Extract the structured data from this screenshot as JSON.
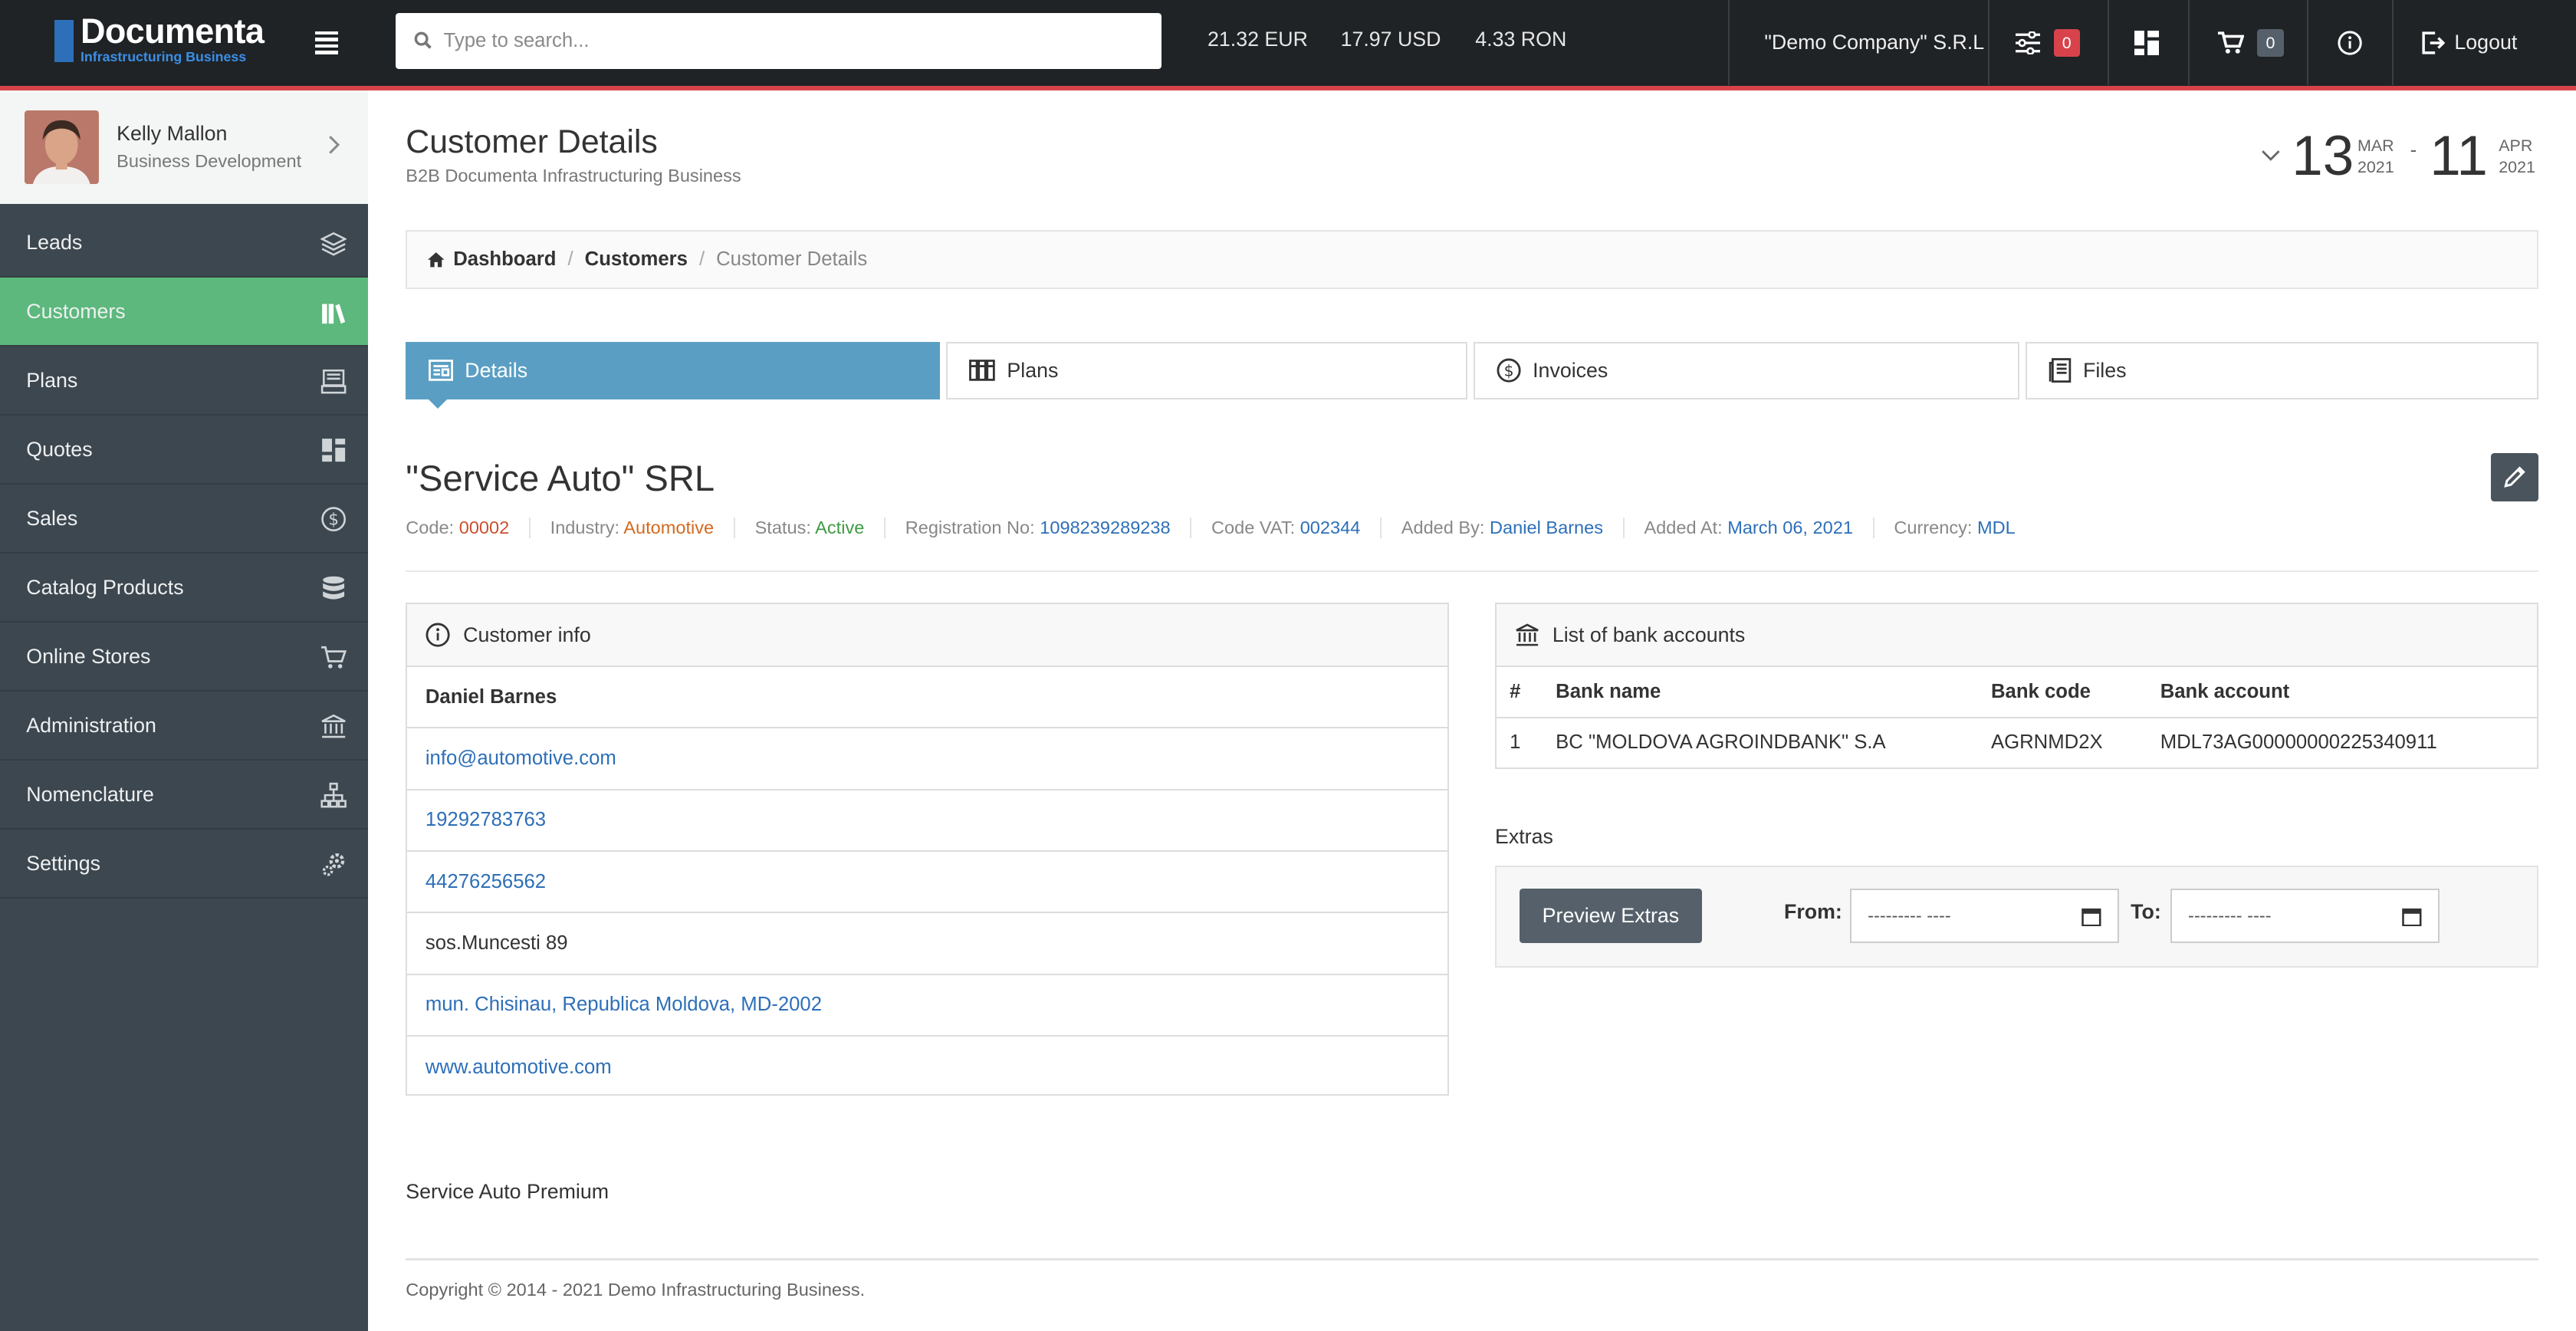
{
  "header": {
    "logo_title": "Documenta",
    "logo_subtitle": "Infrastructuring Business",
    "search_placeholder": "Type to search...",
    "rates": [
      "21.32 EUR",
      "17.97 USD",
      "4.33 RON"
    ],
    "company": "\"Demo Company\" S.R.L",
    "filters_badge": "0",
    "cart_badge": "0",
    "logout_label": "Logout",
    "colors": {
      "bar": "#1f2326",
      "accent_line": "#d8434b",
      "badge_red": "#d8434b",
      "badge_dark": "#55606a"
    }
  },
  "profile": {
    "name": "Kelly Mallon",
    "role": "Business Development"
  },
  "sidebar": {
    "items": [
      {
        "label": "Leads",
        "icon": "layers-icon"
      },
      {
        "label": "Customers",
        "icon": "books-icon",
        "active": true
      },
      {
        "label": "Plans",
        "icon": "register-icon"
      },
      {
        "label": "Quotes",
        "icon": "quotes-icon"
      },
      {
        "label": "Sales",
        "icon": "dollar-circle-icon"
      },
      {
        "label": "Catalog Products",
        "icon": "database-icon"
      },
      {
        "label": "Online Stores",
        "icon": "cart-icon"
      },
      {
        "label": "Administration",
        "icon": "bank-icon"
      },
      {
        "label": "Nomenclature",
        "icon": "sitemap-icon"
      },
      {
        "label": "Settings",
        "icon": "gears-icon"
      }
    ],
    "active_color": "#5cb87c"
  },
  "page": {
    "title": "Customer Details",
    "subtitle": "B2B Documenta Infrastructuring Business",
    "date_from": {
      "day": "13",
      "month": "MAR",
      "year": "2021"
    },
    "date_sep": "-",
    "date_to": {
      "day": "11",
      "month": "APR",
      "year": "2021"
    }
  },
  "breadcrumb": {
    "items": [
      "Dashboard",
      "Customers"
    ],
    "current": "Customer Details"
  },
  "tabs": [
    {
      "label": "Details",
      "icon": "details-icon",
      "active": true
    },
    {
      "label": "Plans",
      "icon": "plans-icon"
    },
    {
      "label": "Invoices",
      "icon": "dollar-circle-icon"
    },
    {
      "label": "Files",
      "icon": "files-icon"
    }
  ],
  "customer": {
    "name": "\"Service Auto\" SRL",
    "meta": [
      {
        "label": "Code:",
        "value": "00002"
      },
      {
        "label": "Industry:",
        "value": "Automotive"
      },
      {
        "label": "Status:",
        "value": "Active"
      },
      {
        "label": "Registration No:",
        "value": "1098239289238"
      },
      {
        "label": "Code VAT:",
        "value": "002344"
      },
      {
        "label": "Added By:",
        "value": "Daniel Barnes"
      },
      {
        "label": "Added At:",
        "value": "March 06, 2021"
      },
      {
        "label": "Currency:",
        "value": "MDL"
      }
    ],
    "info_title": "Customer info",
    "contact": "Daniel Barnes",
    "email": "info@automotive.com",
    "phone1": "19292783763",
    "phone2": "44276256562",
    "street": "sos.Muncesti 89",
    "city": "mun. Chisinau, Republica Moldova, MD-2002",
    "website": "www.automotive.com",
    "plan_text": "Service Auto Premium"
  },
  "bank": {
    "title": "List of bank accounts",
    "columns": [
      "#",
      "Bank name",
      "Bank code",
      "Bank account"
    ],
    "rows": [
      [
        "1",
        "BC \"MOLDOVA AGROINDBANK\" S.A",
        "AGRNMD2X",
        "MDL73AG00000000225340911"
      ]
    ]
  },
  "extras": {
    "title": "Extras",
    "button": "Preview Extras",
    "from_label": "From:",
    "to_label": "To:",
    "from_value": "--------- ----",
    "to_value": "--------- ----"
  },
  "footer": {
    "copyright": "Copyright © 2014 - 2021 Demo Infrastructuring Business."
  }
}
